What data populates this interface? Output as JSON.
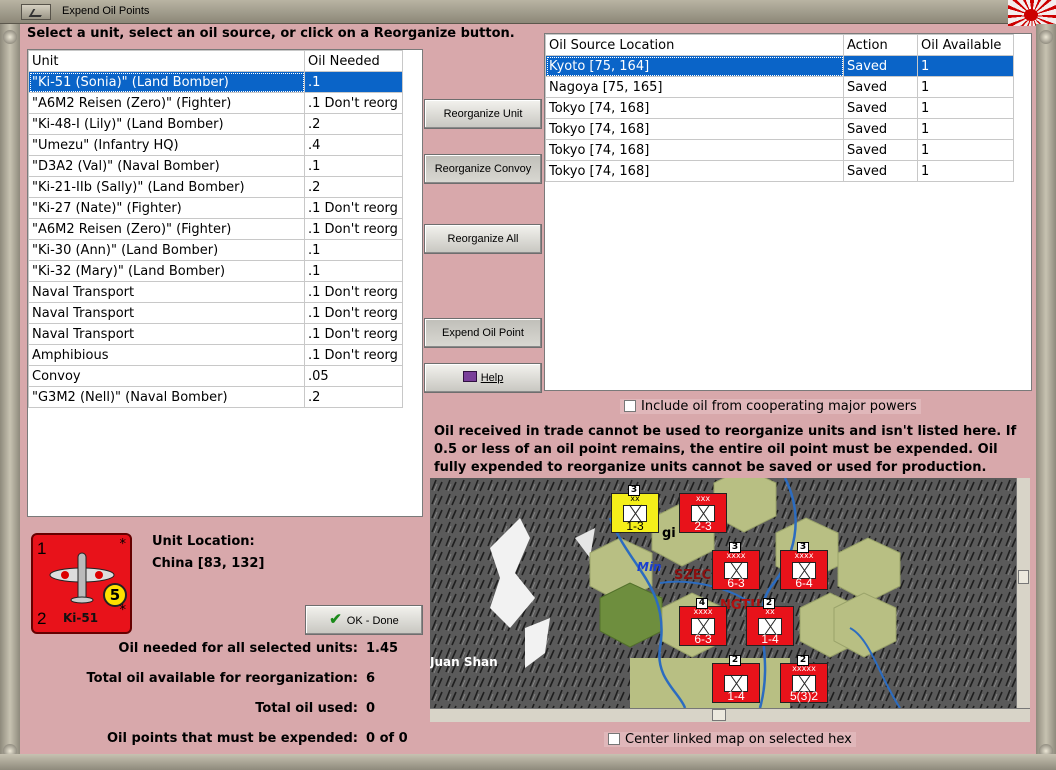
{
  "window": {
    "title": "Expend Oil Points"
  },
  "instruction": "Select a unit, select an oil source, or click on a Reorganize button.",
  "units_table": {
    "columns": [
      "Unit",
      "Oil Needed"
    ],
    "rows": [
      {
        "unit": "\"Ki-51 (Sonia)\" (Land Bomber)",
        "oil": ".1",
        "selected": true
      },
      {
        "unit": "\"A6M2 Reisen (Zero)\" (Fighter)",
        "oil": ".1 Don't reorg"
      },
      {
        "unit": "\"Ki-48-I (Lily)\" (Land Bomber)",
        "oil": ".2"
      },
      {
        "unit": "\"Umezu\" (Infantry HQ)",
        "oil": ".4"
      },
      {
        "unit": "\"D3A2 (Val)\" (Naval Bomber)",
        "oil": ".1"
      },
      {
        "unit": "\"Ki-21-IIb (Sally)\" (Land Bomber)",
        "oil": ".2"
      },
      {
        "unit": "\"Ki-27 (Nate)\" (Fighter)",
        "oil": ".1 Don't reorg"
      },
      {
        "unit": "\"A6M2 Reisen (Zero)\" (Fighter)",
        "oil": ".1 Don't reorg"
      },
      {
        "unit": "\"Ki-30 (Ann)\" (Land Bomber)",
        "oil": ".1"
      },
      {
        "unit": "\"Ki-32 (Mary)\" (Land Bomber)",
        "oil": ".1"
      },
      {
        "unit": "Naval Transport",
        "oil": ".1 Don't reorg"
      },
      {
        "unit": "Naval Transport",
        "oil": ".1 Don't reorg"
      },
      {
        "unit": "Naval Transport",
        "oil": ".1 Don't reorg"
      },
      {
        "unit": "Amphibious",
        "oil": ".1 Don't reorg"
      },
      {
        "unit": "Convoy",
        "oil": ".05"
      },
      {
        "unit": "\"G3M2 (Nell)\" (Naval Bomber)",
        "oil": ".2"
      }
    ]
  },
  "buttons": {
    "reorganize_unit": "Reorganize Unit",
    "reorganize_convoy": "Reorganize Convoy",
    "reorganize_all": "Reorganize All",
    "expend_oil_point": "Expend Oil Point",
    "help": "Help",
    "ok_done": "OK - Done"
  },
  "oil_table": {
    "columns": [
      "Oil Source Location",
      "Action",
      "Oil Available"
    ],
    "rows": [
      {
        "location": "Kyoto [75, 164]",
        "action": "Saved",
        "available": "1",
        "selected": true
      },
      {
        "location": "Nagoya [75, 165]",
        "action": "Saved",
        "available": "1"
      },
      {
        "location": "Tokyo [74, 168]",
        "action": "Saved",
        "available": "1"
      },
      {
        "location": "Tokyo [74, 168]",
        "action": "Saved",
        "available": "1"
      },
      {
        "location": "Tokyo [74, 168]",
        "action": "Saved",
        "available": "1"
      },
      {
        "location": "Tokyo [74, 168]",
        "action": "Saved",
        "available": "1"
      }
    ]
  },
  "include_oil_checkbox": {
    "label": "Include oil from cooperating major powers",
    "checked": false
  },
  "notice": "Oil received in trade cannot be used to reorganize units and isn't listed here.  If 0.5 or less of an oil point remains, the entire oil point must be expended.   Oil fully expended to reorganize units cannot be saved or used for production.",
  "selected_unit": {
    "card": {
      "top_left": "1",
      "bottom_left": "2",
      "badge": "5",
      "name": "Ki-51",
      "color": "#e8121a"
    },
    "location_label": "Unit Location:",
    "location_value": "China [83, 132]"
  },
  "summary": {
    "oil_needed_label": "Oil needed for all selected units:",
    "oil_needed_value": "1.45",
    "total_available_label": "Total oil available for reorganization:",
    "total_available_value": "6",
    "total_used_label": "Total oil used:",
    "total_used_value": "0",
    "must_expend_label": "Oil points that must be expended:",
    "must_expend_value": "0 of 0"
  },
  "map": {
    "labels": {
      "river": "Min",
      "region": "SZEC",
      "city": "NGTU",
      "mountain": "Juan Shan",
      "fragment": "gi"
    },
    "counters": [
      {
        "size": "xx",
        "stat": "1-3",
        "tag": "3",
        "color": "#f5ef1a"
      },
      {
        "size": "xxx",
        "stat": "2-3",
        "tag": "",
        "color": "#e8121a"
      },
      {
        "size": "xxxx",
        "stat": "6-3",
        "tag": "3",
        "color": "#e8121a"
      },
      {
        "size": "xxxx",
        "stat": "6-4",
        "tag": "3",
        "color": "#e8121a"
      },
      {
        "size": "xxxx",
        "stat": "6-3",
        "tag": "4",
        "color": "#e8121a"
      },
      {
        "size": "xx",
        "stat": "1-4",
        "tag": "2",
        "color": "#e8121a"
      },
      {
        "size": "",
        "stat": "1-4",
        "tag": "2",
        "color": "#e8121a"
      },
      {
        "size": "xxxxx",
        "stat": "5(3)2",
        "tag": "2",
        "color": "#e8121a"
      }
    ]
  },
  "center_map_checkbox": {
    "label": "Center linked map on selected hex",
    "checked": false
  }
}
